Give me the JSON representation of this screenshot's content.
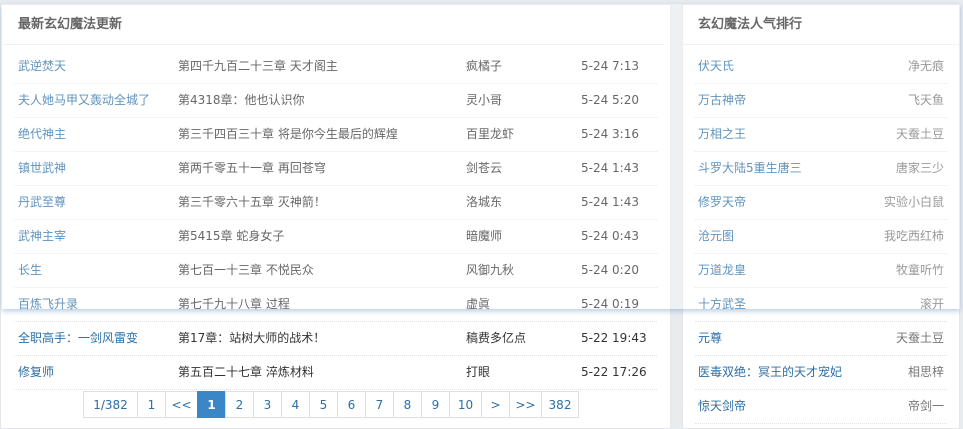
{
  "latest": {
    "title": "最新玄幻魔法更新",
    "rows": [
      {
        "name": "武逆焚天",
        "chapter": "第四千九百二十三章 天才阁主",
        "author": "疯橘子",
        "time": "5-24 7:13"
      },
      {
        "name": "夫人她马甲又轰动全城了",
        "chapter": "第4318章：他也认识你",
        "author": "灵小哥",
        "time": "5-24 5:20"
      },
      {
        "name": "绝代神主",
        "chapter": "第三千四百三十章 将是你今生最后的辉煌",
        "author": "百里龙虾",
        "time": "5-24 3:16"
      },
      {
        "name": "镇世武神",
        "chapter": "第两千零五十一章 再回苍穹",
        "author": "剑苍云",
        "time": "5-24 1:43"
      },
      {
        "name": "丹武至尊",
        "chapter": "第三千零六十五章 灭神箭！",
        "author": "洛城东",
        "time": "5-24 1:43"
      },
      {
        "name": "武神主宰",
        "chapter": "第5415章 蛇身女子",
        "author": "暗魔师",
        "time": "5-24 0:43"
      },
      {
        "name": "长生",
        "chapter": "第七百一十三章 不悦民众",
        "author": "风御九秋",
        "time": "5-24 0:20"
      },
      {
        "name": "百炼飞升录",
        "chapter": "第七千九十八章 过程",
        "author": "虚眞",
        "time": "5-24 0:19"
      },
      {
        "name": "全职高手：一剑风雷变",
        "chapter": "第17章：站树大师的战术！",
        "author": "稿费多亿点",
        "time": "5-22 19:43"
      },
      {
        "name": "修复师",
        "chapter": "第五百二十七章 淬炼材料",
        "author": "打眼",
        "time": "5-22 17:26"
      }
    ]
  },
  "ranking": {
    "title": "玄幻魔法人气排行",
    "rows": [
      {
        "name": "伏天氏",
        "author": "净无痕"
      },
      {
        "name": "万古神帝",
        "author": "飞天鱼"
      },
      {
        "name": "万相之王",
        "author": "天蚕土豆"
      },
      {
        "name": "斗罗大陆5重生唐三",
        "author": "唐家三少"
      },
      {
        "name": "修罗天帝",
        "author": "实验小白鼠"
      },
      {
        "name": "沧元图",
        "author": "我吃西红柿"
      },
      {
        "name": "万道龙皇",
        "author": "牧童听竹"
      },
      {
        "name": "十方武圣",
        "author": "滚开"
      },
      {
        "name": "元尊",
        "author": "天蚕土豆"
      },
      {
        "name": "医毒双绝：冥王的天才宠妃",
        "author": "相思梓"
      },
      {
        "name": "惊天剑帝",
        "author": "帝剑一"
      }
    ]
  },
  "pagination": {
    "items": [
      {
        "label": "1/382",
        "w": 55
      },
      {
        "label": "1",
        "w": 29
      },
      {
        "label": "<<",
        "w": 33
      },
      {
        "label": "1",
        "w": 29,
        "active": true
      },
      {
        "label": "2",
        "w": 29
      },
      {
        "label": "3",
        "w": 29
      },
      {
        "label": "4",
        "w": 29
      },
      {
        "label": "5",
        "w": 29
      },
      {
        "label": "6",
        "w": 29
      },
      {
        "label": "7",
        "w": 29
      },
      {
        "label": "8",
        "w": 29
      },
      {
        "label": "9",
        "w": 29
      },
      {
        "label": "10",
        "w": 33
      },
      {
        "label": ">",
        "w": 29
      },
      {
        "label": ">>",
        "w": 33
      },
      {
        "label": "382",
        "w": 38
      }
    ]
  }
}
